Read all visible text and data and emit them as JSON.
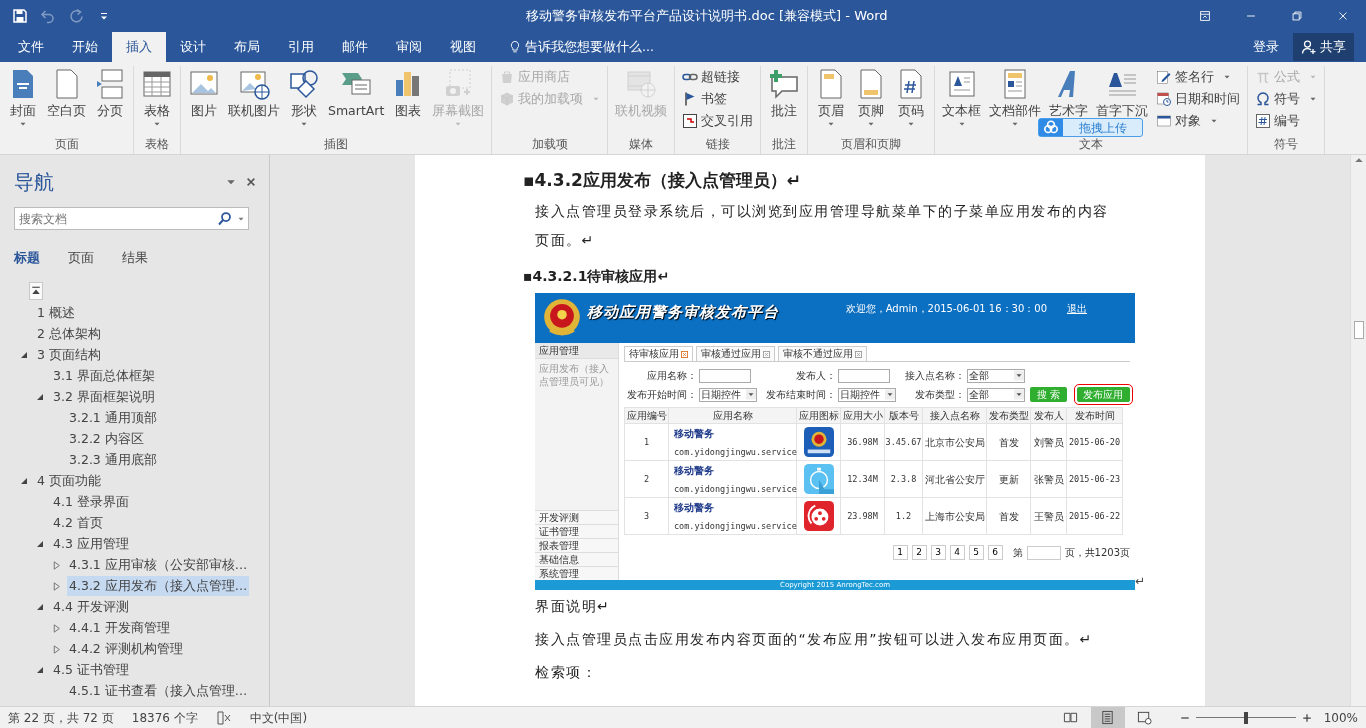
{
  "window": {
    "title": "移动警务审核发布平台产品设计说明书.doc [兼容模式] - Word"
  },
  "quick_access": [
    {
      "disabled": false
    },
    {
      "disabled": true
    },
    {
      "disabled": true
    },
    {
      "disabled": false
    }
  ],
  "tabs": [
    {
      "label": "文件",
      "selected": false
    },
    {
      "label": "开始",
      "selected": false
    },
    {
      "label": "插入",
      "selected": true
    },
    {
      "label": "设计",
      "selected": false
    },
    {
      "label": "布局",
      "selected": false
    },
    {
      "label": "引用",
      "selected": false
    },
    {
      "label": "邮件",
      "selected": false
    },
    {
      "label": "审阅",
      "selected": false
    },
    {
      "label": "视图",
      "selected": false
    }
  ],
  "tell_me": "告诉我您想要做什么...",
  "sign_in": "登录",
  "share": "共享",
  "ribbon": [
    {
      "label": "页面",
      "items": [
        {
          "label": "封面",
          "kind": "large",
          "dropdown": true,
          "disabled": false
        },
        {
          "label": "空白页",
          "kind": "large",
          "dropdown": false,
          "disabled": false
        },
        {
          "label": "分页",
          "kind": "large",
          "dropdown": false,
          "disabled": false
        }
      ]
    },
    {
      "label": "表格",
      "items": [
        {
          "label": "表格",
          "kind": "large",
          "dropdown": true,
          "disabled": false
        }
      ]
    },
    {
      "label": "插图",
      "items": [
        {
          "label": "图片",
          "kind": "large",
          "dropdown": false,
          "disabled": false
        },
        {
          "label": "联机图片",
          "kind": "large",
          "dropdown": false,
          "disabled": false
        },
        {
          "label": "形状",
          "kind": "large",
          "dropdown": true,
          "disabled": false
        },
        {
          "label": "SmartArt",
          "kind": "large",
          "dropdown": false,
          "disabled": false
        },
        {
          "label": "图表",
          "kind": "large",
          "dropdown": false,
          "disabled": false
        },
        {
          "label": "屏幕截图",
          "kind": "large",
          "dropdown": true,
          "disabled": true
        }
      ]
    },
    {
      "label": "加载项",
      "items": [
        {
          "label": "应用商店",
          "kind": "small",
          "dropdown": false,
          "disabled": true
        },
        {
          "label": "我的加载项",
          "kind": "small",
          "dropdown": true,
          "disabled": true
        }
      ]
    },
    {
      "label": "媒体",
      "items": [
        {
          "label": "联机视频",
          "kind": "large",
          "dropdown": false,
          "disabled": true
        }
      ]
    },
    {
      "label": "链接",
      "items": [
        {
          "label": "超链接",
          "kind": "small",
          "dropdown": false,
          "disabled": false
        },
        {
          "label": "书签",
          "kind": "small",
          "dropdown": false,
          "disabled": false
        },
        {
          "label": "交叉引用",
          "kind": "small",
          "dropdown": false,
          "disabled": false
        }
      ]
    },
    {
      "label": "批注",
      "items": [
        {
          "label": "批注",
          "kind": "large",
          "dropdown": false,
          "disabled": false
        }
      ]
    },
    {
      "label": "页眉和页脚",
      "items": [
        {
          "label": "页眉",
          "kind": "large",
          "dropdown": true,
          "disabled": false
        },
        {
          "label": "页脚",
          "kind": "large",
          "dropdown": true,
          "disabled": false
        },
        {
          "label": "页码",
          "kind": "large",
          "dropdown": true,
          "disabled": false
        }
      ]
    },
    {
      "label": "文本",
      "items": [
        {
          "label": "文本框",
          "kind": "large",
          "dropdown": true,
          "disabled": false
        },
        {
          "label": "文档部件",
          "kind": "large",
          "dropdown": true,
          "disabled": false
        },
        {
          "label": "艺术字",
          "kind": "large",
          "dropdown": false,
          "disabled": false
        },
        {
          "label": "首字下沉",
          "kind": "large",
          "dropdown": false,
          "disabled": false
        },
        {
          "label": "签名行",
          "kind": "small",
          "dropdown": true,
          "disabled": false
        },
        {
          "label": "日期和时间",
          "kind": "small",
          "dropdown": false,
          "disabled": false
        },
        {
          "label": "对象",
          "kind": "small",
          "dropdown": true,
          "disabled": false
        }
      ]
    },
    {
      "label": "符号",
      "items": [
        {
          "label": "公式",
          "kind": "small",
          "dropdown": true,
          "disabled": true
        },
        {
          "label": "符号",
          "kind": "small",
          "dropdown": true,
          "disabled": false
        },
        {
          "label": "编号",
          "kind": "small",
          "dropdown": false,
          "disabled": false
        }
      ]
    }
  ],
  "upload_button": "拖拽上传",
  "navigation": {
    "title": "导航",
    "search": {
      "placeholder": "搜索文档"
    },
    "tabs": [
      {
        "label": "标题",
        "selected": true
      },
      {
        "label": "页面",
        "selected": false
      },
      {
        "label": "结果",
        "selected": false
      }
    ],
    "headings": [
      {
        "label": "1 概述",
        "kind": "leaf",
        "selected": false
      },
      {
        "label": "2 总体架构",
        "kind": "leaf",
        "selected": false
      },
      {
        "label": "3 页面结构",
        "kind": "branch",
        "expanded": true,
        "selected": false,
        "children": [
          {
            "label": "3.1 界面总体框架",
            "kind": "leaf",
            "selected": false
          },
          {
            "label": "3.2 界面框架说明",
            "kind": "branch",
            "expanded": true,
            "selected": false,
            "children": [
              {
                "label": "3.2.1 通用顶部",
                "kind": "leaf",
                "selected": false
              },
              {
                "label": "3.2.2 内容区",
                "kind": "leaf",
                "selected": false
              },
              {
                "label": "3.2.3 通用底部",
                "kind": "leaf",
                "selected": false
              }
            ]
          }
        ]
      },
      {
        "label": "4 页面功能",
        "kind": "branch",
        "expanded": true,
        "selected": false,
        "children": [
          {
            "label": "4.1 登录界面",
            "kind": "leaf",
            "selected": false
          },
          {
            "label": "4.2 首页",
            "kind": "leaf",
            "selected": false
          },
          {
            "label": "4.3 应用管理",
            "kind": "branch",
            "expanded": true,
            "selected": false,
            "children": [
              {
                "label": "4.3.1 应用审核（公安部审核…",
                "kind": "branch",
                "expanded": false,
                "selected": false
              },
              {
                "label": "4.3.2 应用发布（接入点管理…",
                "kind": "branch",
                "expanded": false,
                "selected": true
              }
            ]
          },
          {
            "label": "4.4 开发评测",
            "kind": "branch",
            "expanded": true,
            "selected": false,
            "children": [
              {
                "label": "4.4.1 开发商管理",
                "kind": "branch",
                "expanded": false,
                "selected": false
              },
              {
                "label": "4.4.2 评测机构管理",
                "kind": "branch",
                "expanded": false,
                "selected": false
              }
            ]
          },
          {
            "label": "4.5 证书管理",
            "kind": "branch",
            "expanded": true,
            "selected": false,
            "children": [
              {
                "label": "4.5.1 证书查看（接入点管理…",
                "kind": "leaf",
                "selected": false
              }
            ]
          }
        ]
      }
    ]
  },
  "document": {
    "blocks": [
      {
        "kind": "heading",
        "text": "▪4.3.2应用发布（接入点管理员）↵"
      },
      {
        "kind": "paragraph",
        "text": "接入点管理员登录系统后，可以浏览到应用管理导航菜单下的子菜单应用发布的内容页面。↵"
      },
      {
        "kind": "subheading",
        "text": "▪4.3.2.1待审核应用↵"
      },
      {
        "kind": "screenshot",
        "mark": "↵",
        "title": "移动应用警务审核发布平台",
        "welcome": "欢迎您，Admin，2015-06-01 16：30：00",
        "logout": "退出",
        "menu_title": "应用管理",
        "menu_item": "应用发布（接入点管理员可见）",
        "menus": [
          "开发评测",
          "证书管理",
          "报表管理",
          "基础信息",
          "系统管理"
        ],
        "tabs": [
          {
            "label": "待审核应用",
            "selected": true
          },
          {
            "label": "审核通过应用",
            "selected": false
          },
          {
            "label": "审核不通过应用",
            "selected": false
          }
        ],
        "filters": [
          {
            "label": "应用名称：",
            "kind": "input"
          },
          {
            "label": "发布人：",
            "kind": "input"
          },
          {
            "label": "接入点名称：",
            "kind": "select",
            "value": "全部"
          },
          {
            "label": "发布开始时间：",
            "kind": "select",
            "value": "日期控件"
          },
          {
            "label": "发布结束时间：",
            "kind": "select",
            "value": "日期控件"
          },
          {
            "label": "发布类型：",
            "kind": "select",
            "value": "全部"
          }
        ],
        "search_button": "搜 索",
        "publish_button": "发布应用",
        "columns": [
          "应用编号",
          "应用名称",
          "应用图标",
          "应用大小",
          "版本号",
          "接入点名称",
          "发布类型",
          "发布人",
          "发布时间"
        ],
        "rows": [
          {
            "no": "1",
            "name": "移动警务",
            "package": "com.yidongjingwu.service",
            "size": "36.98M",
            "version": "3.45.67",
            "site": "北京市公安局",
            "type": "首发",
            "publisher": "刘警员",
            "date": "2015-06-20"
          },
          {
            "no": "2",
            "name": "移动警务",
            "package": "com.yidongjingwu.service",
            "size": "12.34M",
            "version": "2.3.8",
            "site": "河北省公安厅",
            "type": "更新",
            "publisher": "张警员",
            "date": "2015-06-23"
          },
          {
            "no": "3",
            "name": "移动警务",
            "package": "com.yidongjingwu.service",
            "size": "23.98M",
            "version": "1.2",
            "site": "上海市公安局",
            "type": "首发",
            "publisher": "王警员",
            "date": "2015-06-22"
          }
        ],
        "pages": [
          "1",
          "2",
          "3",
          "4",
          "5",
          "6"
        ],
        "page_prefix": "第",
        "page_suffix": "页，共1203页",
        "footer": "Copyright 2015 AnrongTec.com"
      },
      {
        "kind": "paragraph",
        "text": "界面说明↵"
      },
      {
        "kind": "paragraph",
        "text": "接入点管理员点击应用发布内容页面的“发布应用”按钮可以进入发布应用页面。↵"
      },
      {
        "kind": "paragraph",
        "text": "检索项："
      }
    ]
  },
  "status_bar": {
    "page": "第 22 页，共 72 页",
    "words": "18376 个字",
    "language": "中文(中国)",
    "views": [
      {
        "selected": false
      },
      {
        "selected": true
      },
      {
        "selected": false
      }
    ],
    "zoom": {
      "level": 0.5,
      "reading": "100%"
    }
  }
}
